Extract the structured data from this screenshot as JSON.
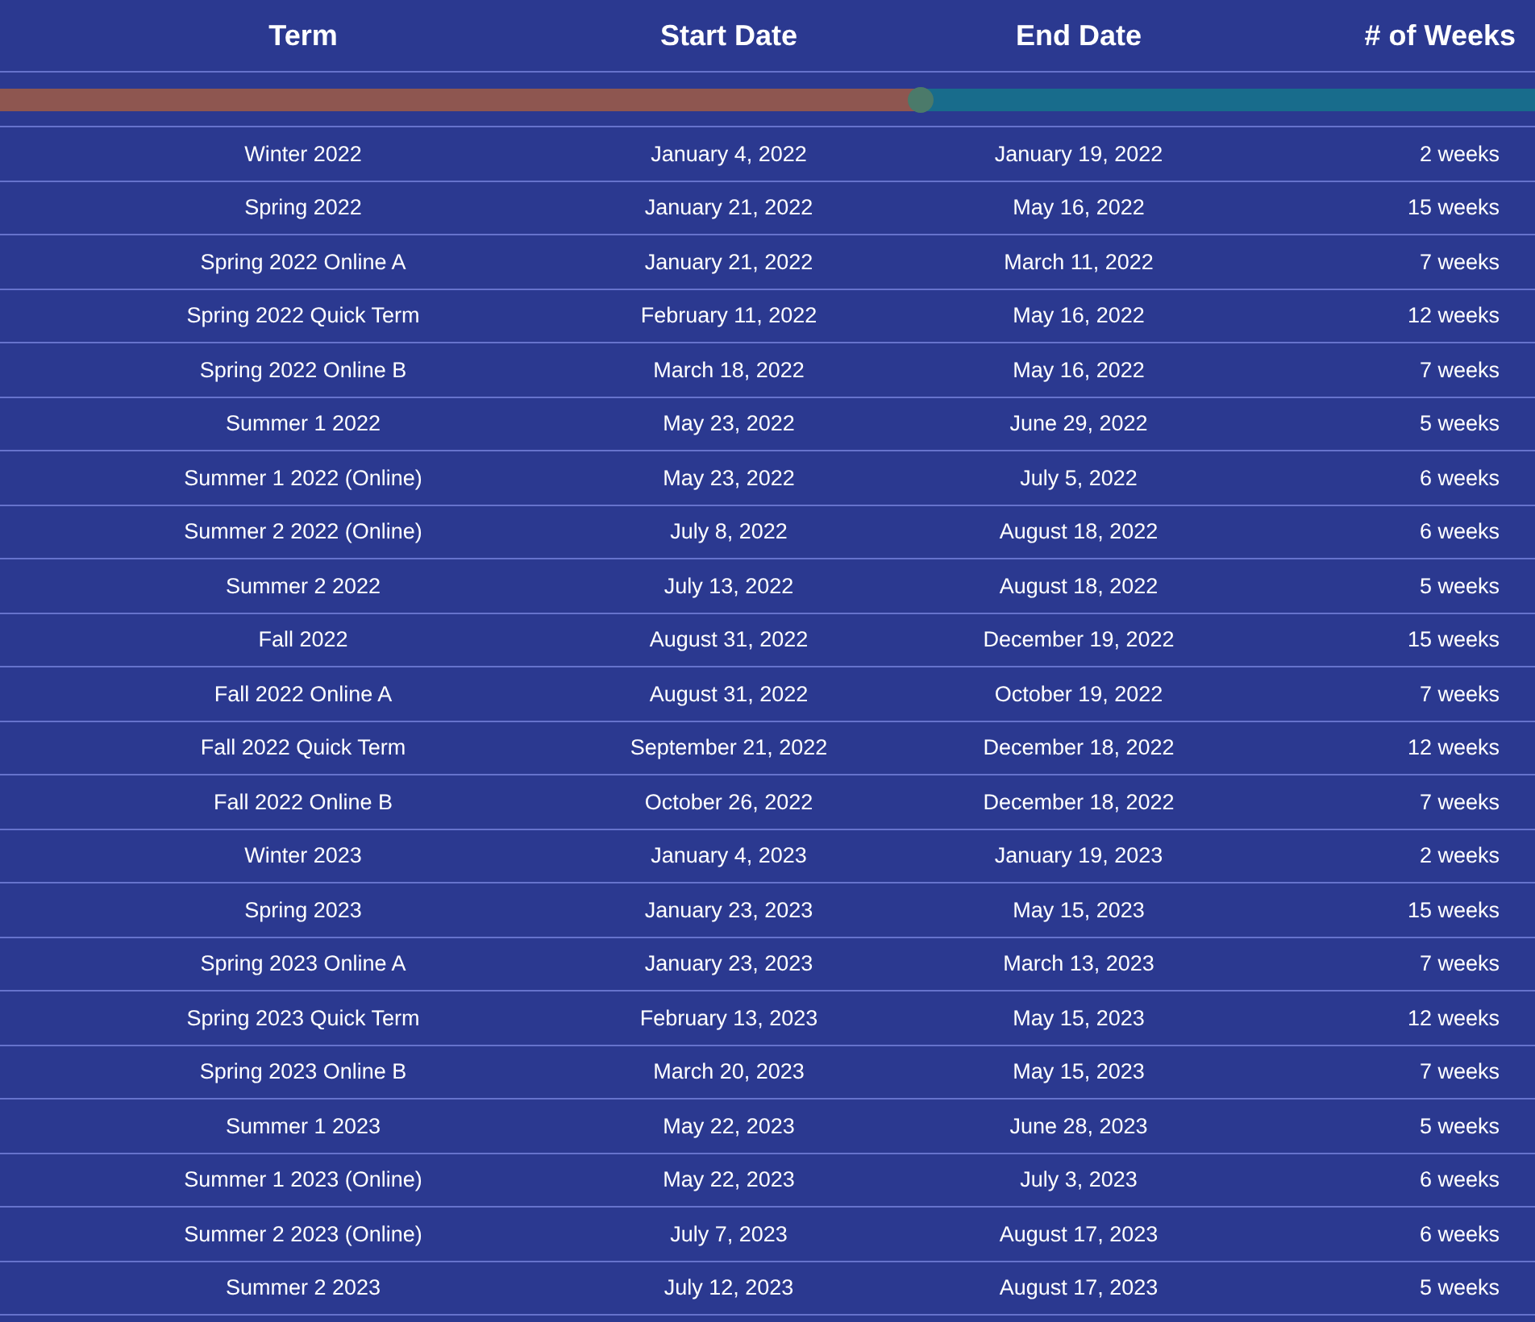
{
  "table": {
    "columns": [
      "Term",
      "Start Date",
      "End Date",
      "# of Weeks"
    ],
    "slider": {
      "level": 0.6
    },
    "rows": [
      [
        "Winter 2022",
        "January 4, 2022",
        "January 19, 2022",
        "2 weeks"
      ],
      [
        "Spring 2022",
        "January 21, 2022",
        "May 16, 2022",
        "15 weeks"
      ],
      [
        "Spring 2022 Online A",
        "January 21, 2022",
        "March 11, 2022",
        "7 weeks"
      ],
      [
        "Spring 2022 Quick Term",
        "February 11, 2022",
        "May 16, 2022",
        "12 weeks"
      ],
      [
        "Spring 2022 Online B",
        "March 18, 2022",
        "May 16, 2022",
        "7 weeks"
      ],
      [
        "Summer 1 2022",
        "May 23, 2022",
        "June 29, 2022",
        "5 weeks"
      ],
      [
        "Summer 1 2022 (Online)",
        "May 23, 2022",
        "July 5, 2022",
        "6 weeks"
      ],
      [
        "Summer 2 2022 (Online)",
        "July 8, 2022",
        "August 18, 2022",
        "6 weeks"
      ],
      [
        "Summer 2 2022",
        "July 13, 2022",
        "August 18, 2022",
        "5 weeks"
      ],
      [
        "Fall 2022",
        "August 31, 2022",
        "December 19, 2022",
        "15 weeks"
      ],
      [
        "Fall 2022 Online A",
        "August 31, 2022",
        "October 19, 2022",
        "7 weeks"
      ],
      [
        "Fall 2022 Quick Term",
        "September 21, 2022",
        "December 18, 2022",
        "12 weeks"
      ],
      [
        "Fall 2022 Online B",
        "October 26, 2022",
        "December 18, 2022",
        "7 weeks"
      ],
      [
        "Winter 2023",
        "January 4, 2023",
        "January 19, 2023",
        "2 weeks"
      ],
      [
        "Spring 2023",
        "January 23, 2023",
        "May 15, 2023",
        "15 weeks"
      ],
      [
        "Spring 2023 Online A",
        "January 23, 2023",
        "March 13, 2023",
        "7 weeks"
      ],
      [
        "Spring 2023 Quick Term",
        "February 13, 2023",
        "May 15, 2023",
        "12 weeks"
      ],
      [
        "Spring 2023 Online B",
        "March 20, 2023",
        "May 15, 2023",
        "7 weeks"
      ],
      [
        "Summer 1 2023",
        "May 22, 2023",
        "June 28, 2023",
        "5 weeks"
      ],
      [
        "Summer 1 2023 (Online)",
        "May 22, 2023",
        "July 3, 2023",
        "6 weeks"
      ],
      [
        "Summer 2 2023 (Online)",
        "July 7, 2023",
        "August 17, 2023",
        "6 weeks"
      ],
      [
        "Summer 2 2023",
        "July 12, 2023",
        "August 17, 2023",
        "5 weeks"
      ]
    ]
  }
}
